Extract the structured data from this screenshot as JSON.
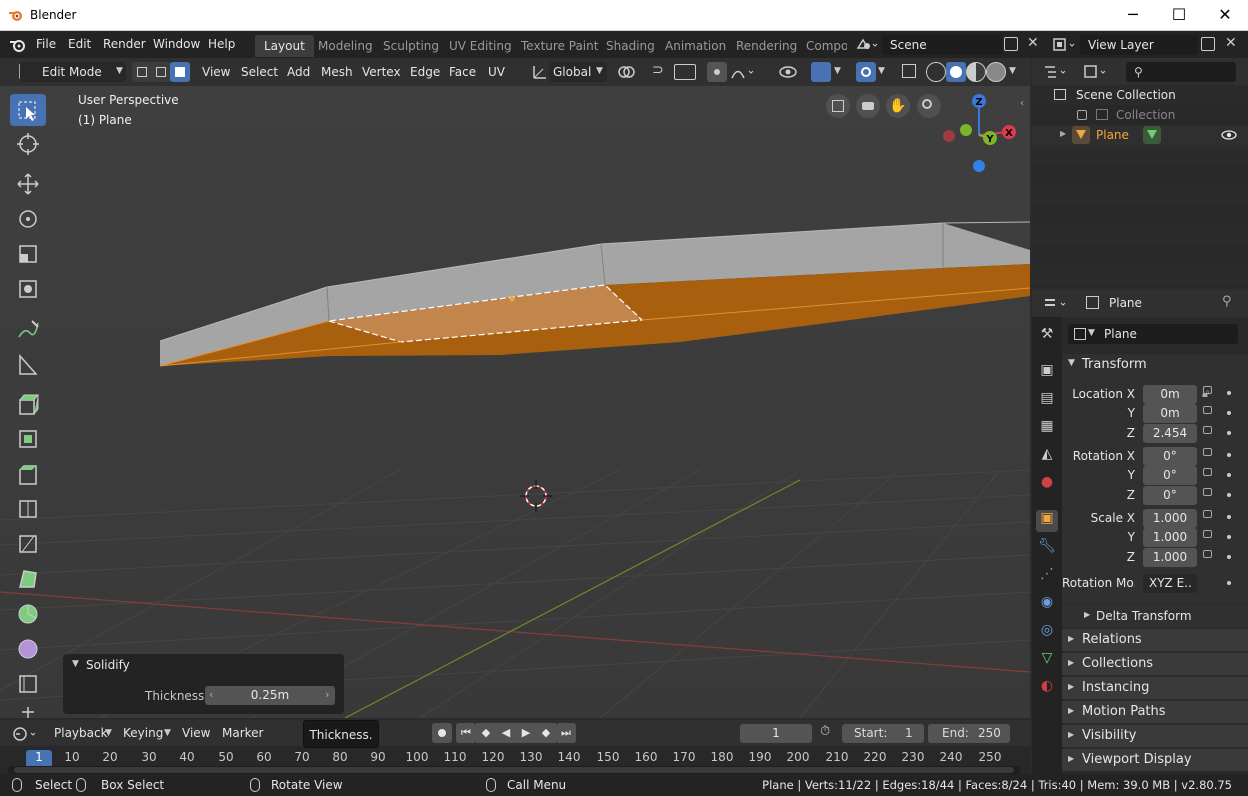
{
  "window": {
    "title": "Blender",
    "minimize": "─",
    "maximize": "☐",
    "close": "✕"
  },
  "menus": [
    "File",
    "Edit",
    "Render",
    "Window",
    "Help"
  ],
  "workspaces": [
    "Layout",
    "Modeling",
    "Sculpting",
    "UV Editing",
    "Texture Paint",
    "Shading",
    "Animation",
    "Rendering",
    "Compo"
  ],
  "scene": {
    "name": "Scene",
    "view_layer": "View Layer"
  },
  "viewport_header": {
    "mode": "Edit Mode",
    "menus": [
      "View",
      "Select",
      "Add",
      "Mesh",
      "Vertex",
      "Edge",
      "Face",
      "UV"
    ],
    "orientation": "Global"
  },
  "viewport": {
    "perspective": "User Perspective",
    "object": "(1) Plane"
  },
  "gizmo": {
    "z": "Z",
    "y": "Y",
    "x": "X"
  },
  "operator_panel": {
    "title": "Solidify",
    "label": "Thickness",
    "value": "0.25m"
  },
  "tooltip": "Thickness.",
  "outliner": {
    "root": "Scene Collection",
    "collection": "Collection",
    "object": "Plane"
  },
  "properties": {
    "header": "Plane",
    "object_name": "Plane",
    "transform_title": "Transform",
    "location": {
      "label": "Location X",
      "x": "0m",
      "y": "0m",
      "z": "2.454"
    },
    "rotation": {
      "label": "Rotation X",
      "x": "0°",
      "y": "0°",
      "z": "0°"
    },
    "scale": {
      "label": "Scale X",
      "x": "1.000",
      "y": "1.000",
      "z": "1.000"
    },
    "axis_y": "Y",
    "axis_z": "Z",
    "rotation_mode": {
      "label": "Rotation Mo..",
      "value": "XYZ E.."
    },
    "delta": "Delta Transform",
    "sections": [
      "Relations",
      "Collections",
      "Instancing",
      "Motion Paths",
      "Visibility",
      "Viewport Display"
    ]
  },
  "timeline": {
    "menus": [
      "Playback",
      "Keying",
      "View",
      "Marker"
    ],
    "current_frame": "1",
    "start_label": "Start:",
    "start": "1",
    "end_label": "End:",
    "end": "250",
    "ruler": [
      "1",
      "10",
      "20",
      "30",
      "40",
      "50",
      "60",
      "70",
      "80",
      "90",
      "100",
      "110",
      "120",
      "130",
      "140",
      "150",
      "160",
      "170",
      "180",
      "190",
      "200",
      "210",
      "220",
      "230",
      "240",
      "250"
    ]
  },
  "status": {
    "select": "Select",
    "box_select": "Box Select",
    "rotate": "Rotate View",
    "call_menu": "Call Menu",
    "stats": "Plane | Verts:11/22 | Edges:18/44 | Faces:8/24 | Tris:40 | Mem: 39.0 MB | v2.80.75"
  },
  "colors": {
    "accent": "#4772b3",
    "orange": "#f5a63a",
    "mesh_top": "#a6a6a6",
    "mesh_bottom": "#b56a13"
  }
}
